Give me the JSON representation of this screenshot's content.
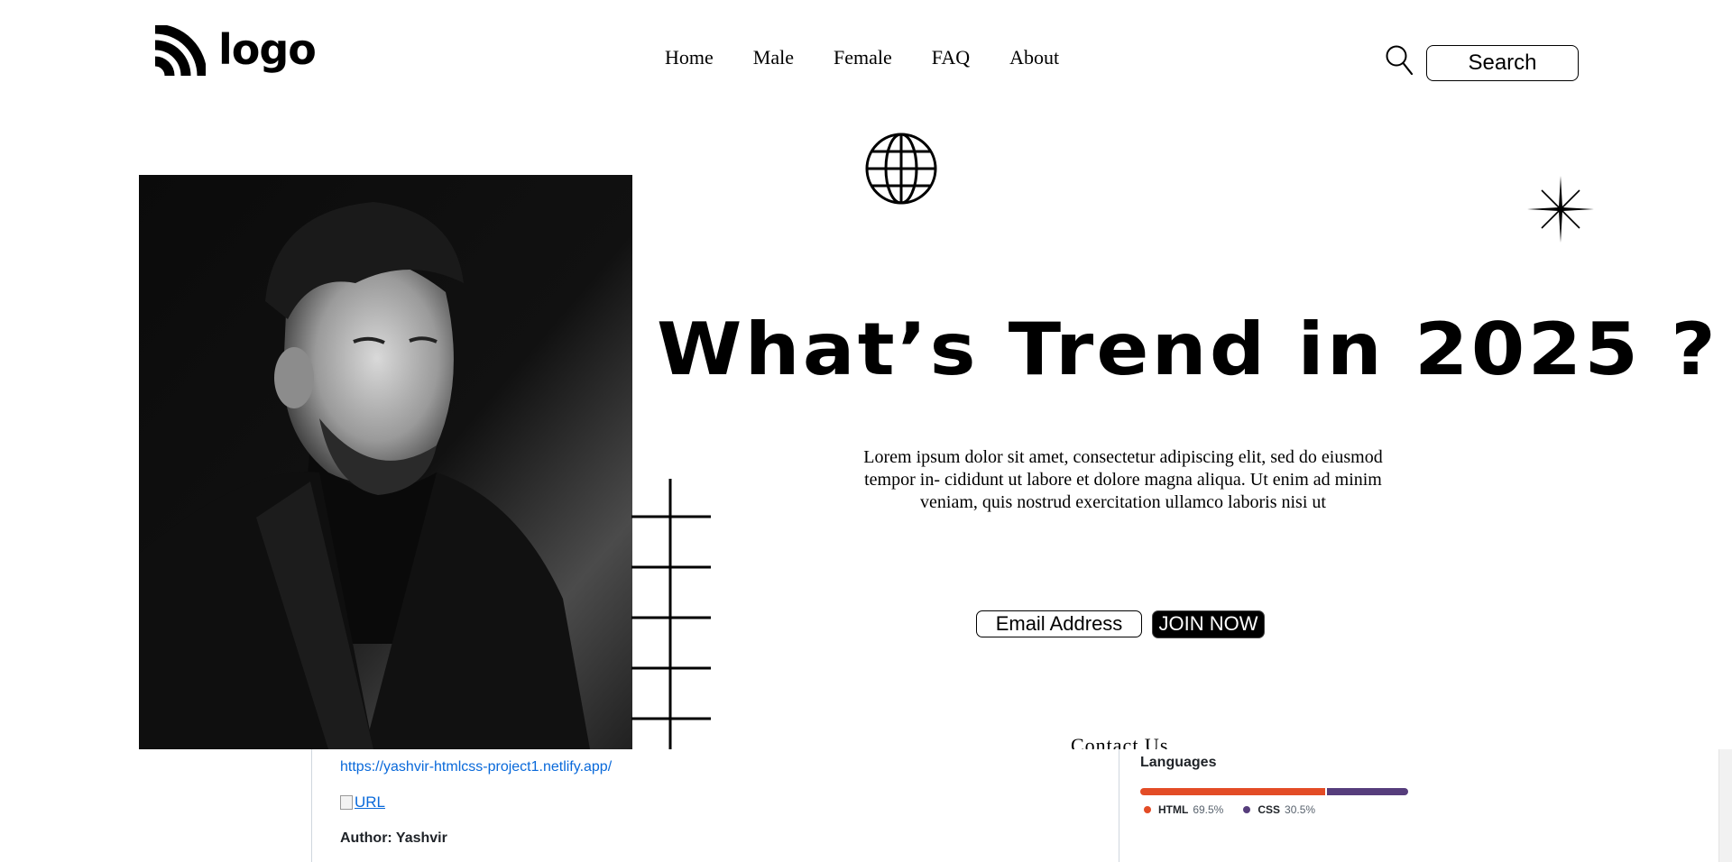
{
  "header": {
    "logo_text": "logo",
    "nav": [
      "Home",
      "Male",
      "Female",
      "FAQ",
      "About"
    ],
    "search_label": "Search",
    "icons": [
      "rss-logo-icon",
      "search-icon"
    ]
  },
  "hero": {
    "headline": "What’s Trend in 2025 ?",
    "lead": "Lorem ipsum dolor sit amet, consectetur adipiscing elit, sed do eiusmod tempor in- cididunt ut labore et dolore magna aliqua. Ut enim ad minim veniam, quis nostrud exercitation ullamco laboris nisi ut",
    "email_placeholder": "Email Address",
    "join_label": "JOIN NOW",
    "contact": "Contact Us",
    "icons": [
      "globe-icon",
      "sparkle-icon"
    ]
  },
  "repo": {
    "link": "https://yashvir-htmlcss-project1.netlify.app/",
    "image_alt": "URL",
    "author": "Author: Yashvir",
    "languages_title": "Languages",
    "languages": [
      {
        "name": "HTML",
        "percent": "69.5%",
        "value": 69.5,
        "color": "#e34c26"
      },
      {
        "name": "CSS",
        "percent": "30.5%",
        "value": 30.5,
        "color": "#563d7c"
      }
    ]
  }
}
